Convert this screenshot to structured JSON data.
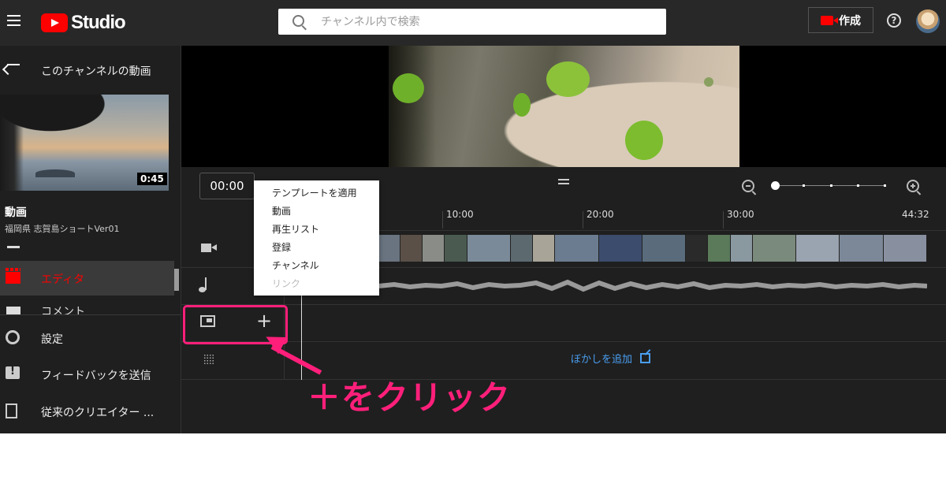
{
  "header": {
    "logo_text": "Studio",
    "search_placeholder": "チャンネル内で検索",
    "create_label": "作成"
  },
  "sidebar": {
    "back_label": "このチャンネルの動画",
    "video": {
      "duration": "0:45",
      "title": "動画",
      "subtitle": "福岡県 志賀島ショートVer01"
    },
    "nav_active": "エディタ",
    "nav_partial": "コメント",
    "bottom_items": [
      {
        "label": "設定",
        "icon": "gear-icon"
      },
      {
        "label": "フィードバックを送信",
        "icon": "feedback-icon"
      },
      {
        "label": "従来のクリエイター ...",
        "icon": "classic-studio-icon"
      }
    ]
  },
  "editor": {
    "current_time": "00:00",
    "ruler_ticks": [
      "10:00",
      "20:00",
      "30:00",
      "44:32"
    ],
    "blur_link": "ぼかしを追加",
    "zoom_level": 0.0
  },
  "menu": {
    "items": [
      {
        "label": "テンプレートを適用",
        "enabled": true
      },
      {
        "label": "動画",
        "enabled": true
      },
      {
        "label": "再生リスト",
        "enabled": true
      },
      {
        "label": "登録",
        "enabled": true
      },
      {
        "label": "チャンネル",
        "enabled": true
      },
      {
        "label": "リンク",
        "enabled": false
      }
    ]
  },
  "annotation": {
    "callout": "＋をクリック",
    "color": "#ff1f7a"
  },
  "colors": {
    "brand_red": "#ff0000",
    "link_blue": "#4a9ef0",
    "highlight_pink": "#ff1f7a"
  }
}
